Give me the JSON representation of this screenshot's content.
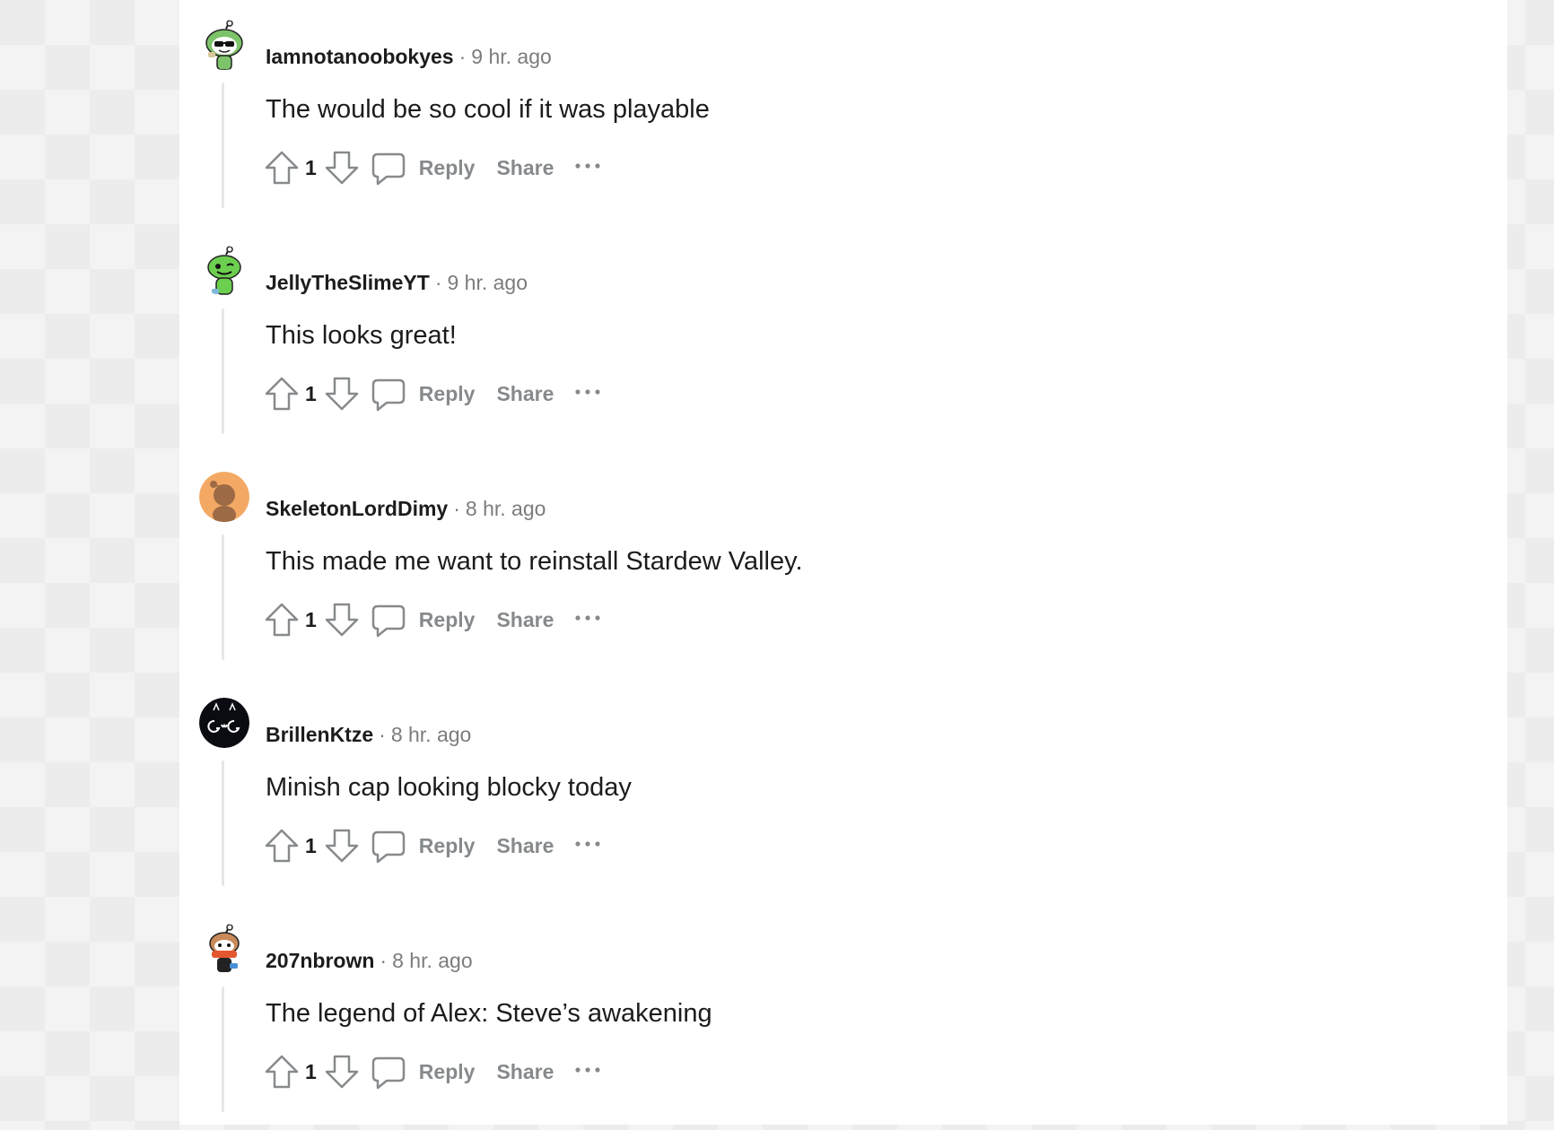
{
  "actions": {
    "reply_label": "Reply",
    "share_label": "Share"
  },
  "comments": [
    {
      "username": "Iamnotanoobokyes",
      "time": "9 hr. ago",
      "text": "The would be so cool if it was playable",
      "score": "1",
      "avatar": "snoo-avatar-green-sunglasses"
    },
    {
      "username": "JellyTheSlimeYT",
      "time": "9 hr. ago",
      "text": "This looks great!",
      "score": "1",
      "avatar": "snoo-avatar-green-wink"
    },
    {
      "username": "SkeletonLordDimy",
      "time": "8 hr. ago",
      "text": "This made me want to reinstall Stardew Valley.",
      "score": "1",
      "avatar": "default-snoo-orange"
    },
    {
      "username": "BrillenKtze",
      "time": "8 hr. ago",
      "text": "Minish cap looking blocky today",
      "score": "1",
      "avatar": "cat-face-avatar"
    },
    {
      "username": "207nbrown",
      "time": "8 hr. ago",
      "text": "The legend of Alex: Steve’s awakening",
      "score": "1",
      "avatar": "snoo-avatar-red-outfit"
    }
  ],
  "colors": {
    "text_primary": "#1c1c1c",
    "text_meta": "#7c7c7c",
    "action_gray": "#878a8c",
    "thread_line": "#e5e7e9"
  }
}
